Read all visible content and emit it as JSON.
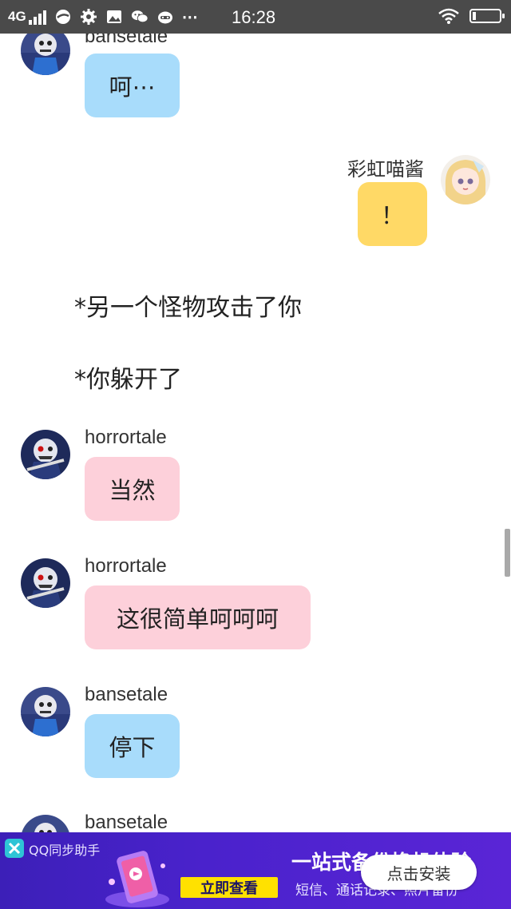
{
  "status_bar": {
    "network": "4G",
    "time": "16:28",
    "more": "⋯",
    "icons": [
      "signal-bars-icon",
      "browser-icon",
      "settings-gear-icon",
      "gallery-icon",
      "wechat-icon",
      "cat-icon",
      "more-dots-icon",
      "wifi-icon",
      "battery-icon"
    ]
  },
  "messages": [
    {
      "sender": "bansetale",
      "text": "呵⋯",
      "side": "left",
      "color": "#a8dcfb"
    },
    {
      "sender": "彩虹喵酱",
      "text": "！",
      "side": "right",
      "color": "#ffd966"
    },
    {
      "sender": "horrortale",
      "text": "当然",
      "side": "left",
      "color": "#fdd0da"
    },
    {
      "sender": "horrortale",
      "text": "这很简单呵呵呵",
      "side": "left",
      "color": "#fdd0da"
    },
    {
      "sender": "bansetale",
      "text": "停下",
      "side": "left",
      "color": "#a8dcfb"
    },
    {
      "sender": "bansetale",
      "text": "",
      "side": "left",
      "color": "#a8dcfb"
    }
  ],
  "narration": [
    "*另一个怪物攻击了你",
    "*你躲开了"
  ],
  "ad": {
    "brand": "QQ同步助手",
    "cta": "立即查看",
    "headline": "一站式备份换机体验",
    "sub": "短信、通话记录、照片备份",
    "install": "点击安装"
  }
}
